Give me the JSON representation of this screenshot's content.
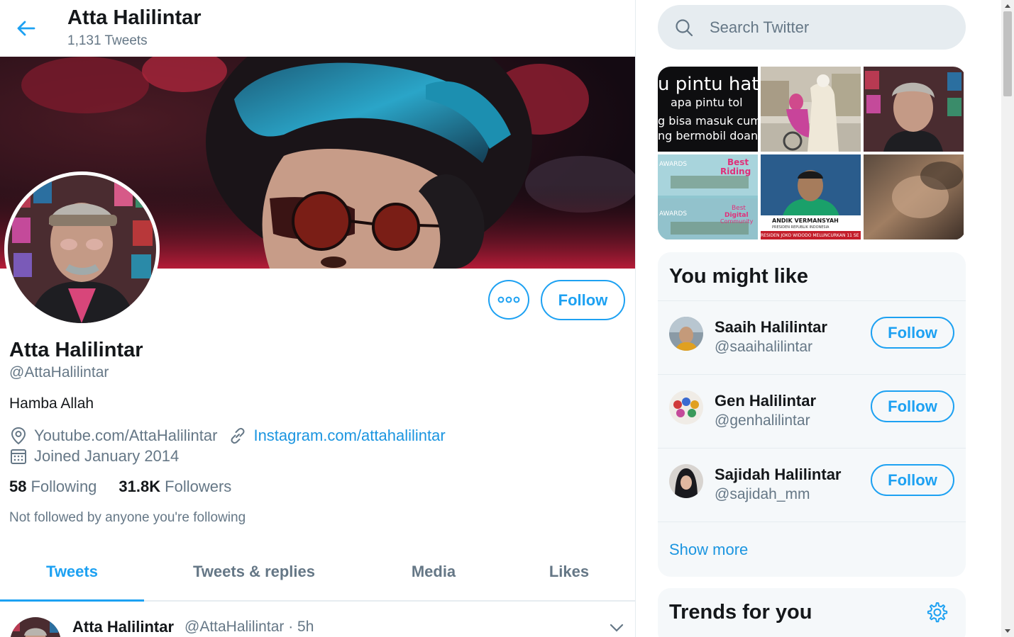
{
  "header": {
    "title": "Atta Halilintar",
    "tweet_count": "1,131 Tweets"
  },
  "profile": {
    "name": "Atta Halilintar",
    "handle": "@AttaHalilintar",
    "bio": "Hamba Allah",
    "location": "Youtube.com/AttaHalilintar",
    "website": "Instagram.com/attahalilintar",
    "joined": "Joined January 2014",
    "following_count": "58",
    "following_label": "Following",
    "followers_count": "31.8K",
    "followers_label": "Followers",
    "not_followed": "Not followed by anyone you're following",
    "follow_label": "Follow"
  },
  "tabs": [
    {
      "label": "Tweets",
      "active": true
    },
    {
      "label": "Tweets & replies",
      "active": false
    },
    {
      "label": "Media",
      "active": false
    },
    {
      "label": "Likes",
      "active": false
    }
  ],
  "tweet": {
    "name": "Atta Halilintar",
    "meta": "@AttaHalilintar · 5h"
  },
  "search": {
    "placeholder": "Search Twitter"
  },
  "media_grid": {
    "thumb1_lines": [
      "u pintu hat",
      "apa pintu tol",
      "g bisa masuk cum",
      "ng bermobil doang"
    ],
    "thumb4_lines": [
      "Best",
      "Riding",
      "AWARDS",
      "Best",
      "Digital",
      "Community",
      "AWARDS"
    ],
    "thumb5_lines": [
      "ANDIK VERMANSYAH",
      "PRESIDEN REPUBLIK INDONESIA",
      "RESIDEN JOKO WIDODO MELUNCURKAN 11 SE"
    ]
  },
  "who_to_follow": {
    "title": "You might like",
    "items": [
      {
        "name": "Saaih Halilintar",
        "handle": "@saaihalilintar",
        "follow": "Follow"
      },
      {
        "name": "Gen Halilintar",
        "handle": "@genhalilintar",
        "follow": "Follow"
      },
      {
        "name": "Sajidah Halilintar",
        "handle": "@sajidah_mm",
        "follow": "Follow"
      }
    ],
    "show_more": "Show more"
  },
  "trends": {
    "title": "Trends for you"
  },
  "colors": {
    "accent": "#1da1f2",
    "link": "#1b95e0",
    "secondary_text": "#657786",
    "panel_bg": "#f5f8fa"
  }
}
